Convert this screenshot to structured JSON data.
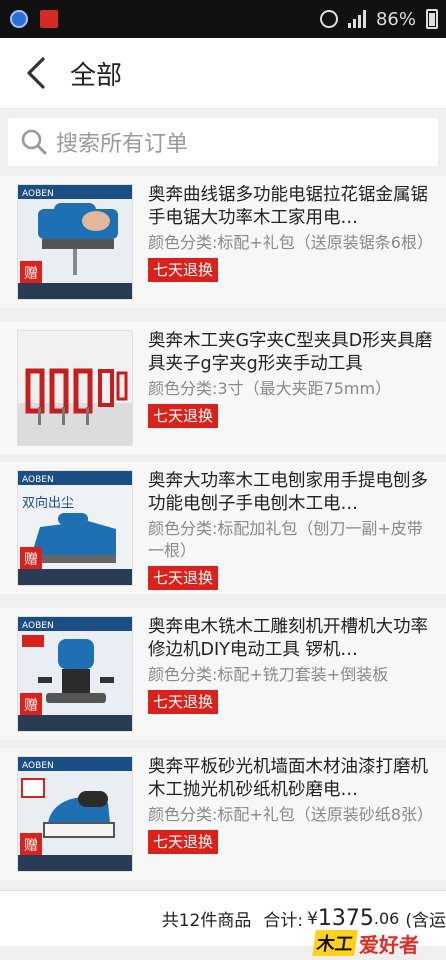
{
  "status_bar": {
    "battery": "86%"
  },
  "header": {
    "title": "全部"
  },
  "search": {
    "placeholder": "搜索所有订单"
  },
  "items": [
    {
      "title": "奥奔曲线锯多功能电锯拉花锯金属锯手电锯大功率木工家用电…",
      "spec": "颜色分类:标配+礼包（送原装锯条6根）",
      "badge": "七天退换"
    },
    {
      "title": "奥奔木工夹G字夹C型夹具D形夹具磨具夹子g字夹g形夹手动工具",
      "spec": "颜色分类:3寸（最大夹距75mm）",
      "badge": "七天退换"
    },
    {
      "title": "奥奔大功率木工电刨家用手提电刨多功能电刨子手电刨木工电…",
      "spec": "颜色分类:标配加礼包（刨刀一副+皮带一根）",
      "badge": "七天退换"
    },
    {
      "title": "奥奔电木铣木工雕刻机开槽机大功率修边机DIY电动工具 锣机…",
      "spec": "颜色分类:标配+铣刀套装+倒装板",
      "badge": "七天退换"
    },
    {
      "title": "奥奔平板砂光机墙面木材油漆打磨机木工抛光机砂纸机砂磨电…",
      "spec": "颜色分类:标配+礼包（送原装砂纸8张）",
      "badge": "七天退换"
    }
  ],
  "thumb_text": {
    "brand": "AOBEN",
    "gift": "赠",
    "banner": "双向出尘"
  },
  "footer": {
    "count": "共12件商品",
    "total_label": "合计:",
    "currency": "¥",
    "total_int": "1375",
    "total_dec": ".06",
    "note": "(含运"
  },
  "watermark": {
    "part1": "木工",
    "part2": "爱好者"
  },
  "colors": {
    "badge": "#d9221c",
    "status_bar": "#111111",
    "page_bg": "#efefef"
  }
}
